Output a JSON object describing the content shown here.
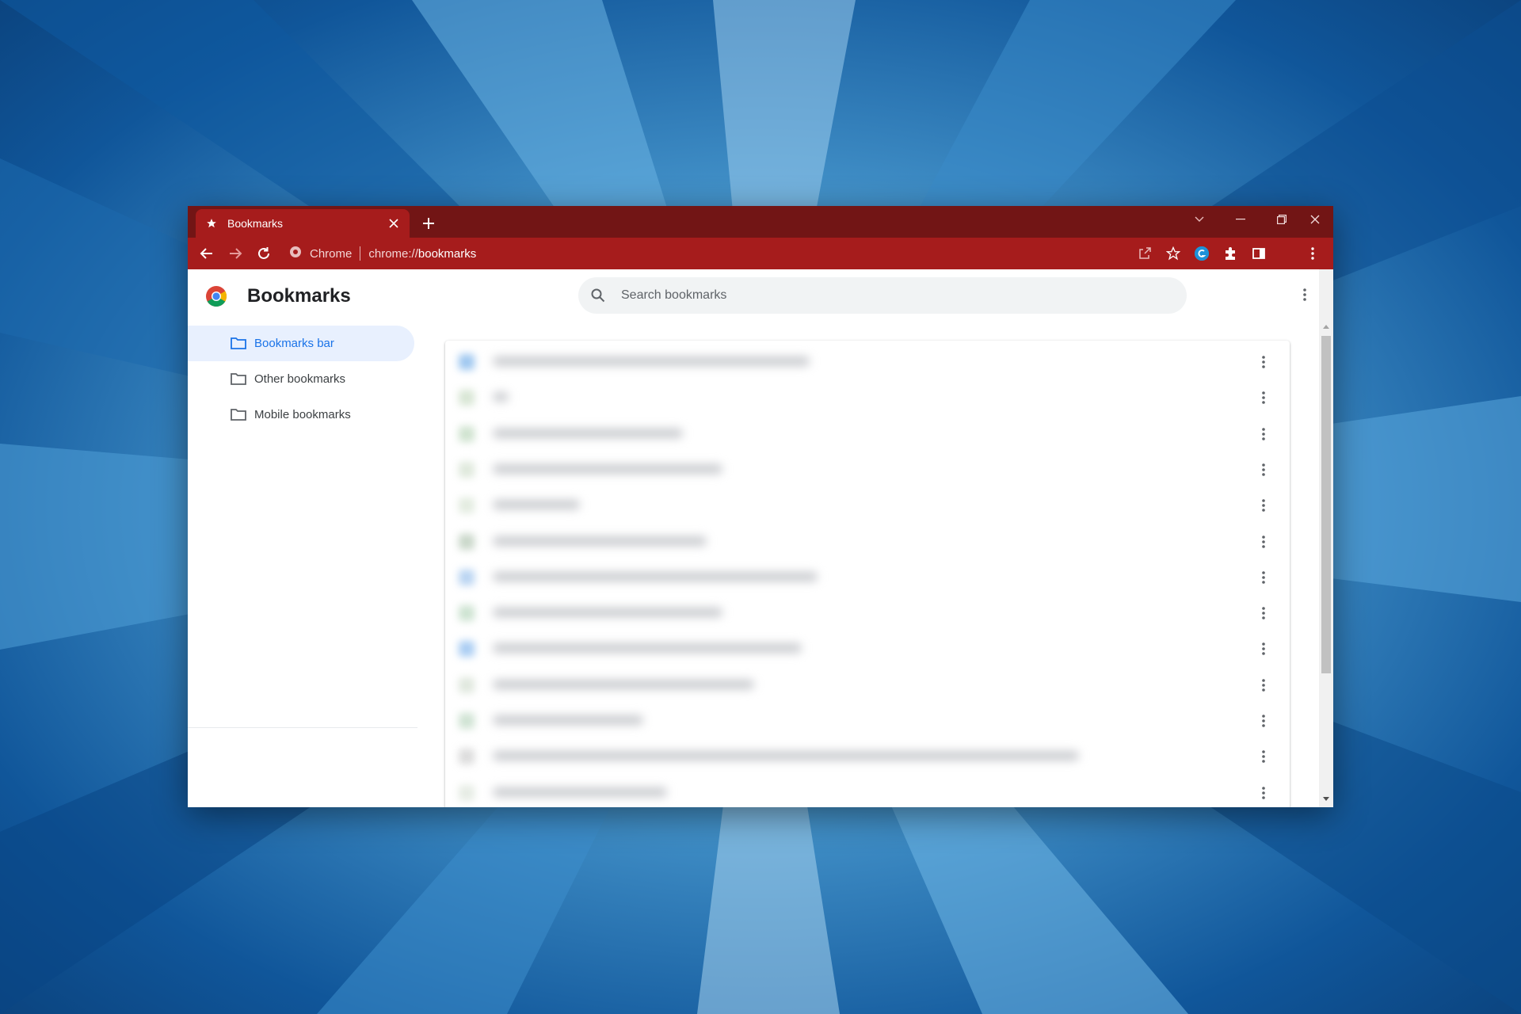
{
  "tab": {
    "title": "Bookmarks",
    "favicon": "star-icon"
  },
  "toolbar": {
    "site_chip": "Chrome",
    "url_scheme": "chrome://",
    "url_host": "bookmarks"
  },
  "page": {
    "title": "Bookmarks",
    "search_placeholder": "Search bookmarks"
  },
  "sidebar": {
    "items": [
      {
        "label": "Bookmarks bar",
        "selected": true
      },
      {
        "label": "Other bookmarks",
        "selected": false
      },
      {
        "label": "Mobile bookmarks",
        "selected": false
      }
    ]
  },
  "colors": {
    "titlebar": "#721515",
    "toolbar": "#a61c1c",
    "accent": "#1a73e8",
    "selected_bg": "#e8f0fe"
  }
}
